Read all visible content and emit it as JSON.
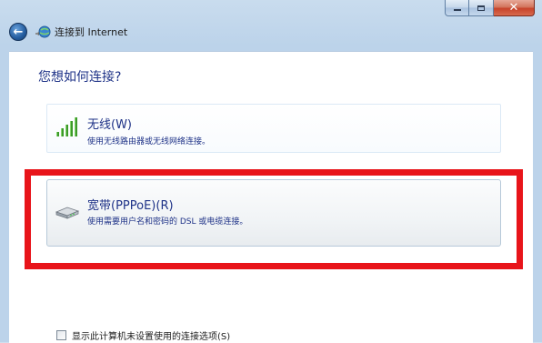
{
  "window": {
    "title": "连接到 Internet"
  },
  "caption_buttons": {
    "minimize_icon": "minimize-icon",
    "maximize_icon": "maximize-icon",
    "close_icon": "close-icon"
  },
  "main": {
    "question": "您想如何连接?",
    "options": [
      {
        "icon": "wireless-signal-icon",
        "title": "无线(W)",
        "description": "使用无线路由器或无线网络连接。"
      },
      {
        "icon": "broadband-modem-icon",
        "title": "宽带(PPPoE)(R)",
        "description": "使用需要用户名和密码的 DSL 或电缆连接。"
      }
    ],
    "highlight_color": "#e8141a"
  },
  "footer": {
    "checkbox_label": "显示此计算机未设置使用的连接选项(S)",
    "checkbox_checked": false
  },
  "colors": {
    "link_blue": "#1e3287",
    "frame": "#bcd3ea"
  }
}
